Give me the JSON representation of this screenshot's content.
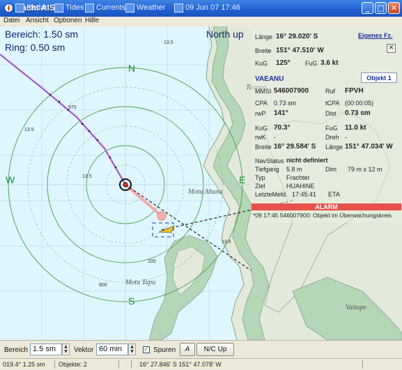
{
  "window": {
    "title": "Yacht AIS",
    "tabs": [
      "Radar",
      "Tides",
      "Currents",
      "Weather",
      "09 Jun 07 17:46"
    ]
  },
  "menu": [
    "Datei",
    "Ansicht",
    "Optionen",
    "Hilfe"
  ],
  "map": {
    "bereich_label": "Bereich: 1.50 sm",
    "ring_label": "Ring: 0.50 sm",
    "orientation": "North up",
    "compass": {
      "n": "N",
      "s": "S",
      "e": "E",
      "w": "W"
    },
    "places": [
      "Motu Ahuna",
      "Motu Tapu",
      "Toopua",
      "Vaitape"
    ],
    "depths": [
      "970",
      "13.5",
      "13.5",
      "13.5",
      "13.5",
      "800",
      "100"
    ],
    "colors": {
      "sea": "#dff6ff",
      "land": "#e3eadb",
      "reef": "#b6d6b8",
      "track": "#d4a0ff",
      "trail": "#f4a8a8"
    }
  },
  "own": {
    "button_eigenes": "Eigenes Fz.",
    "lange_label": "Länge",
    "lange_value": "16° 29.020' S",
    "breite_label": "Breite",
    "breite_value": "151° 47.510' W",
    "kug_label": "KuG",
    "kug_value": "125°",
    "fug_label": "FuG",
    "fug_value": "3.6 kt"
  },
  "target": {
    "name": "VAEANU",
    "button_objekt": "Objekt 1",
    "mmsi_label": "MMSI",
    "mmsi_value": "546007900",
    "ruf_label": "Ruf",
    "ruf_value": "FPVH",
    "cpa_label": "CPA",
    "cpa_value": "0.73 sm",
    "tcpa_label": "tCPA",
    "tcpa_value": "(00:00:05)",
    "rwp_label": "rwP",
    "rwp_value": "141°",
    "dist_label": "Dist",
    "dist_value": "0.73 sm",
    "kug_label": "KuG",
    "kug_value": "70.3°",
    "fug_label": "FuG",
    "fug_value": "11.0 kt",
    "rwk_label": "rwK",
    "rwk_value": "-",
    "dreh_label": "Dreh",
    "dreh_value": "-",
    "breite_label": "Breite",
    "breite_value": "16° 29.584' S",
    "lange_label": "Länge",
    "lange_value": "151° 47.034' W",
    "navstatus_label": "NavStatus",
    "navstatus_value": "nicht definiert",
    "tiefgang_label": "Tiefgang",
    "tiefgang_value": "5.8 m",
    "dim_label": "Dim",
    "dim_value": "79 m x 12 m",
    "typ_label": "Typ",
    "typ_value": "Frachter",
    "ziel_label": "Ziel",
    "ziel_value": "HUAHINE",
    "letzte_label": "LetzteMeld.",
    "letzte_value": "17:45:41",
    "eta_label": "ETA"
  },
  "alarm": {
    "label": "ALARM",
    "message": "*09 17:45 546007900: Objekt im Überwachungskreis"
  },
  "controls": {
    "bereich_label": "Bereich",
    "bereich_value": "1.5 sm",
    "vektor_label": "Vektor",
    "vektor_value": "60 min",
    "spuren_label": "Spuren",
    "a_button": "A",
    "nc_button": "N/C Up"
  },
  "status": {
    "bearing": "019.4°  1.25 sm",
    "objekte": "Objekte: 2",
    "cursor": "16° 27.846' S 151° 47.078' W"
  }
}
